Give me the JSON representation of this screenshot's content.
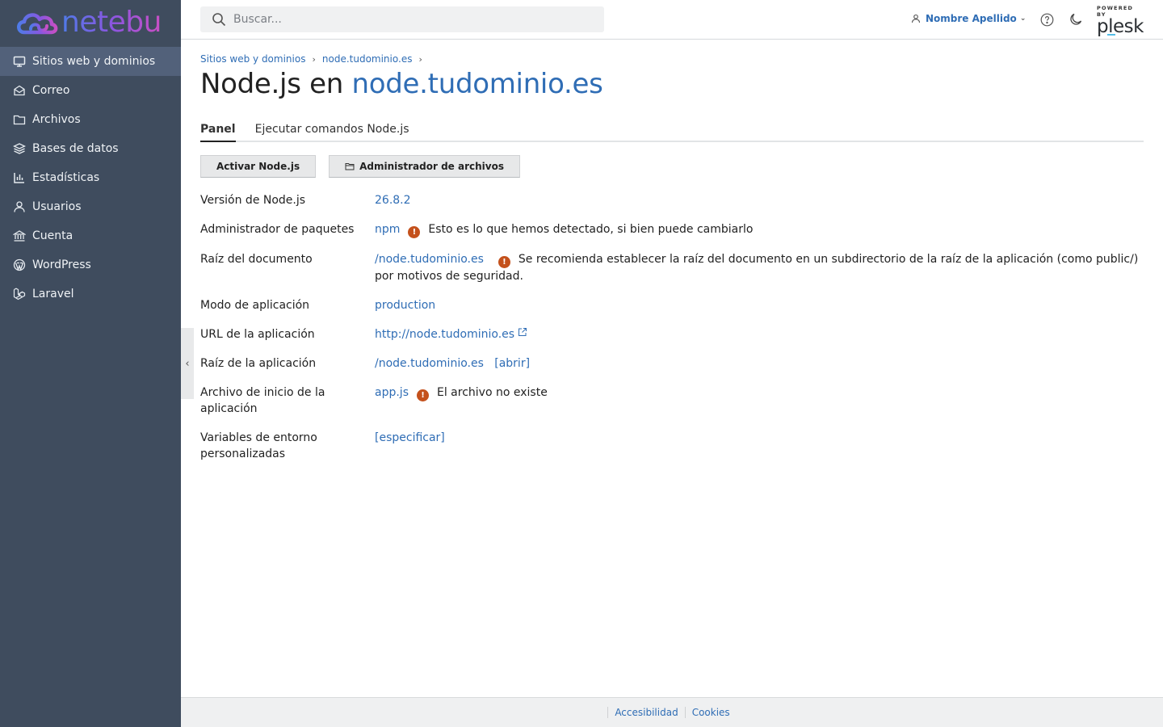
{
  "brand": {
    "name": "netebu"
  },
  "sidebar": {
    "items": [
      {
        "label": "Sitios web y dominios",
        "icon": "monitor-icon",
        "active": true
      },
      {
        "label": "Correo",
        "icon": "mail-icon"
      },
      {
        "label": "Archivos",
        "icon": "folder-icon"
      },
      {
        "label": "Bases de datos",
        "icon": "database-icon"
      },
      {
        "label": "Estadísticas",
        "icon": "bar-chart-icon"
      },
      {
        "label": "Usuarios",
        "icon": "user-icon"
      },
      {
        "label": "Cuenta",
        "icon": "bank-icon"
      },
      {
        "label": "WordPress",
        "icon": "wordpress-icon"
      },
      {
        "label": "Laravel",
        "icon": "laravel-icon"
      }
    ]
  },
  "header": {
    "search_placeholder": "Buscar...",
    "user_name": "Nombre Apellido",
    "powered_by": "POWERED BY",
    "plesk": "plesk"
  },
  "breadcrumb": [
    "Sitios web y dominios",
    "node.tudominio.es"
  ],
  "page": {
    "title_prefix": "Node.js en ",
    "title_link": "node.tudominio.es"
  },
  "tabs": [
    "Panel",
    "Ejecutar comandos Node.js"
  ],
  "toolbar": {
    "activate_label": "Activar Node.js",
    "file_manager_label": "Administrador de archivos"
  },
  "info": {
    "node_version": {
      "label": "Versión de Node.js",
      "value": "26.8.2"
    },
    "package_manager": {
      "label": "Administrador de paquetes",
      "value": "npm",
      "warning": "Esto es lo que hemos detectado, si bien puede cambiarlo"
    },
    "document_root": {
      "label": "Raíz del documento",
      "value": "/node.tudominio.es",
      "warning": "Se recomienda establecer la raíz del documento en un subdirectorio de la raíz de la aplicación (como public/) por motivos de seguridad."
    },
    "app_mode": {
      "label": "Modo de aplicación",
      "value": "production"
    },
    "app_url": {
      "label": "URL de la aplicación",
      "value": "http://node.tudominio.es"
    },
    "app_root": {
      "label": "Raíz de la aplicación",
      "value": "/node.tudominio.es",
      "action": "[abrir]"
    },
    "startup_file": {
      "label": "Archivo de inicio de la aplicación",
      "value": "app.js",
      "warning": "El archivo no existe"
    },
    "env_vars": {
      "label": "Variables de entorno personalizadas",
      "action": "[especificar]"
    }
  },
  "footer": {
    "links": [
      "Accesibilidad",
      "Cookies"
    ]
  },
  "colors": {
    "sidebar_bg": "#3f4c5e",
    "sidebar_active": "#52617a",
    "link": "#2f6db5",
    "warning": "#c4511c"
  }
}
